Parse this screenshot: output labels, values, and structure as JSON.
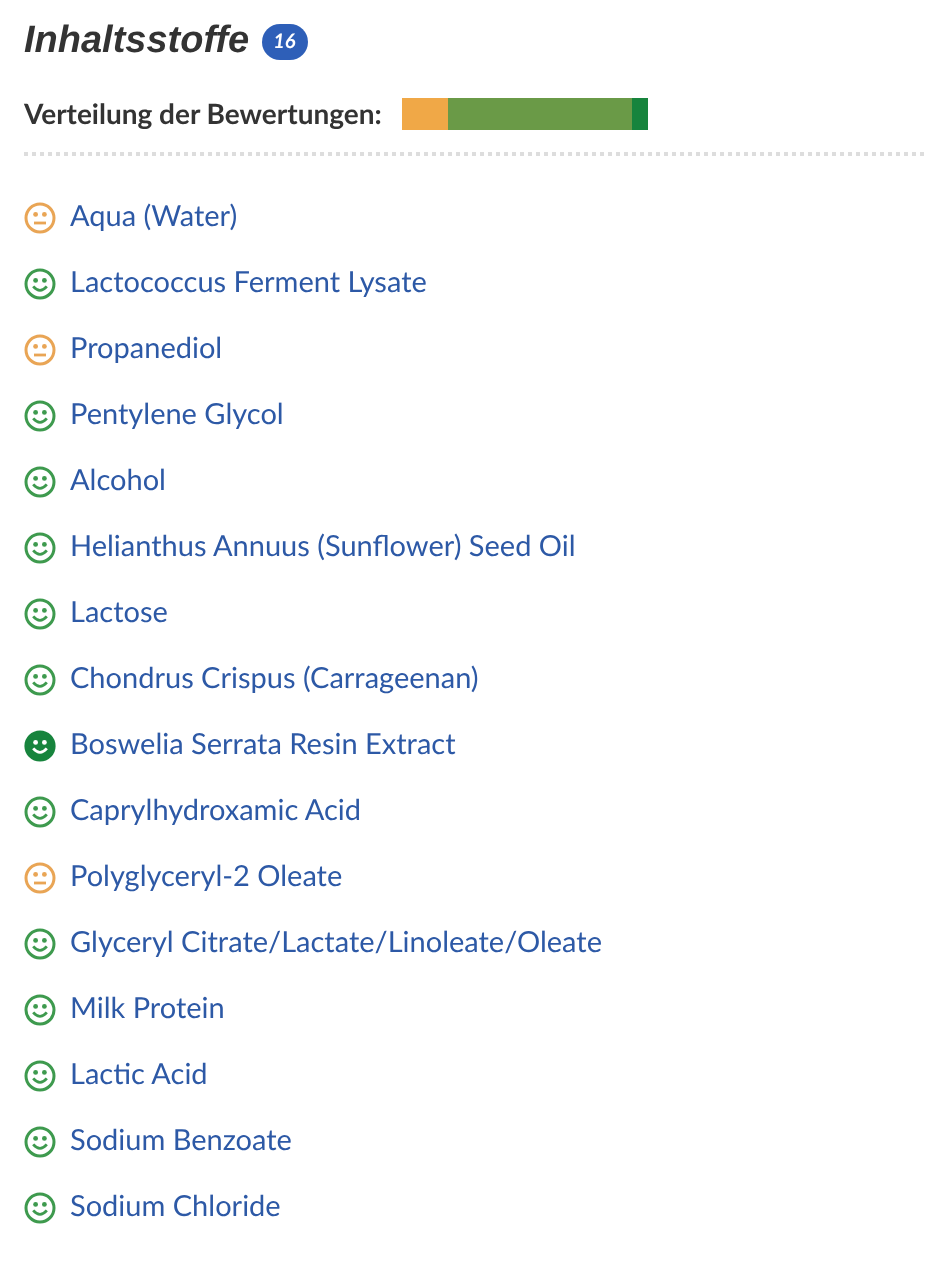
{
  "heading": {
    "title": "Inhaltsstoffe",
    "count": "16"
  },
  "distribution": {
    "label": "Verteilung der Bewertungen:",
    "segments": [
      {
        "kind": "neutral",
        "color": "#f0a847"
      },
      {
        "kind": "good",
        "color": "#6a9a47"
      },
      {
        "kind": "very_good",
        "color": "#17843d"
      }
    ]
  },
  "ingredients": [
    {
      "name": "Aqua (Water)",
      "kind": "neutral"
    },
    {
      "name": "Lactococcus Ferment Lysate",
      "kind": "good"
    },
    {
      "name": "Propanediol",
      "kind": "neutral"
    },
    {
      "name": "Pentylene Glycol",
      "kind": "good"
    },
    {
      "name": "Alcohol",
      "kind": "good"
    },
    {
      "name": "Helianthus Annuus (Sunflower) Seed Oil",
      "kind": "good"
    },
    {
      "name": "Lactose",
      "kind": "good"
    },
    {
      "name": "Chondrus Crispus (Carrageenan)",
      "kind": "good"
    },
    {
      "name": "Boswelia Serrata Resin Extract",
      "kind": "very_good"
    },
    {
      "name": "Caprylhydroxamic Acid",
      "kind": "good"
    },
    {
      "name": "Polyglyceryl-2 Oleate",
      "kind": "neutral"
    },
    {
      "name": "Glyceryl Citrate/Lactate/Linoleate/Oleate",
      "kind": "good"
    },
    {
      "name": "Milk Protein",
      "kind": "good"
    },
    {
      "name": "Lactic Acid",
      "kind": "good"
    },
    {
      "name": "Sodium Benzoate",
      "kind": "good"
    },
    {
      "name": "Sodium Chloride",
      "kind": "good"
    }
  ]
}
